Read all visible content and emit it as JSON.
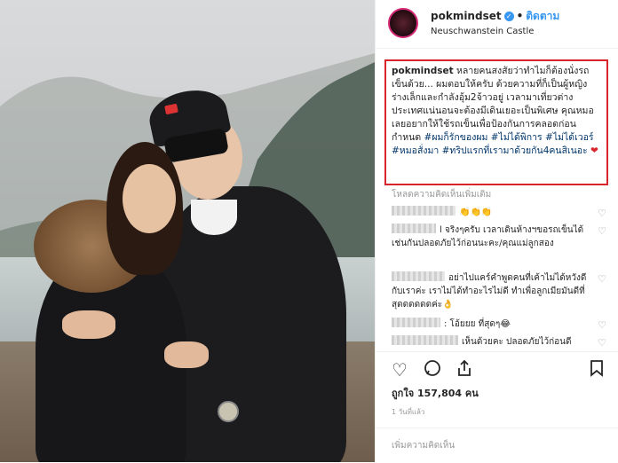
{
  "post": {
    "username": "pokmindset",
    "follow_label": "ติดตาม",
    "location": "Neuschwanstein Castle",
    "caption_user": "pokmindset",
    "caption_text": "หลายคนสงสัยว่าทำไมก็ต้องนั่งรถเข็นด้วย... ผมตอบให้ครับ ด้วยความที่ก็เป็นผู้หญิงร่างเล็กและกำลังอุ้ม2จ้าวอยู่ เวลามาเที่ยวต่างประเทศแน่นอนจะต้องมีเดินเยอะเป็นพิเศษ คุณหมอเลยอยากให้ใช้รถเข็นเพื่อป้องกันการคลอดก่อนกำหนด",
    "caption_hashtags": "#ผมก็รักของผม #ไม่ได้พิการ #ไม่ได้เวอร์ #หมอสั่งมา #ทริปแรกที่เรามาด้วยกัน4คนสิเนอะ",
    "heart": "❤",
    "load_more": "โหลดความคิดเห็นเพิ่มเติม"
  },
  "comments": [
    {
      "text": "👏👏👏",
      "name_width": 72
    },
    {
      "text": "l จริงๆครับ เวลาเดินห้างฯขอรถเข็นได้เช่นกันปลอดภัยไว้ก่อนนะคะ/คุณแม่ลูกสอง",
      "name_width": 50
    },
    {
      "text": "อย่าไปแคร์คำพูดคนที่เค้าไม่ได้หวังดีกับเราค่ะ เราไม่ได้ทำอะไรไม่ดี ทำเพื่อลูกเมียมันดีที่สุดดดดดดค่ะ👌",
      "name_width": 60
    },
    {
      "text": ": โอ้ยยย ที่สุดๆ😂",
      "name_width": 55
    },
    {
      "text": "เห็นด้วยคะ ปลอดภัยไว้ก่อนดี",
      "name_width": 75
    }
  ],
  "likes_text": "ถูกใจ 157,804 คน",
  "time_text": "1 วันที่แล้ว",
  "add_comment_placeholder": "เพิ่มความคิดเห็น",
  "icons": {
    "heart": "heart-icon",
    "comment": "comment-icon",
    "share": "share-icon",
    "bookmark": "bookmark-icon"
  },
  "colors": {
    "highlight_border": "#d9242b",
    "link_blue": "#3897f0"
  }
}
